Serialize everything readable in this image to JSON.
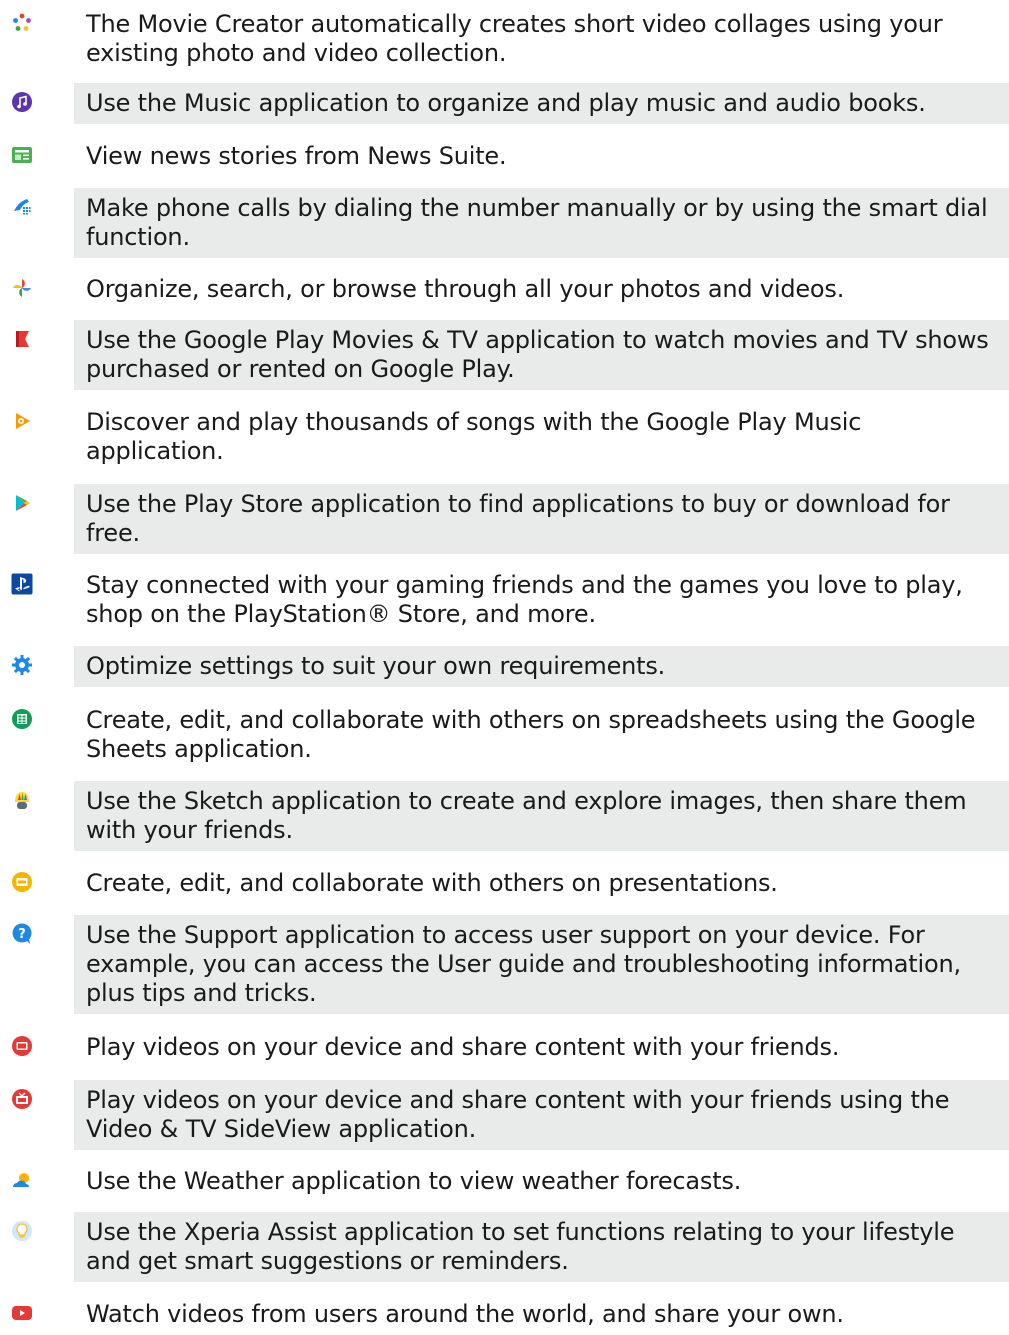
{
  "items": [
    {
      "icon": "movie-creator-icon",
      "text": "The Movie Creator automatically creates short video collages using your existing photo and video collection."
    },
    {
      "icon": "music-icon",
      "text": "Use the Music application to organize and play music and audio books."
    },
    {
      "icon": "news-icon",
      "text": "View news stories from News Suite."
    },
    {
      "icon": "phone-icon",
      "text": "Make phone calls by dialing the number manually or by using the smart dial function."
    },
    {
      "icon": "photos-icon",
      "text": "Organize, search, or browse through all your photos and videos."
    },
    {
      "icon": "play-movies-icon",
      "text": "Use the Google Play Movies & TV application to watch movies and TV shows purchased or rented on Google Play."
    },
    {
      "icon": "play-music-icon",
      "text": "Discover and play thousands of songs with the Google Play Music application."
    },
    {
      "icon": "play-store-icon",
      "text": "Use the Play Store application to find applications to buy or download for free."
    },
    {
      "icon": "playstation-icon",
      "text": "Stay connected with your gaming friends and the games you love to play, shop on the PlayStation® Store, and more."
    },
    {
      "icon": "settings-icon",
      "text": "Optimize settings to suit your own requirements."
    },
    {
      "icon": "sheets-icon",
      "text": "Create, edit, and collaborate with others on spreadsheets using the Google Sheets application."
    },
    {
      "icon": "sketch-icon",
      "text": "Use the Sketch application to create and explore images, then share them with your friends."
    },
    {
      "icon": "slides-icon",
      "text": "Create, edit, and collaborate with others on presentations."
    },
    {
      "icon": "support-icon",
      "text": "Use the Support application to access user support on your device. For example, you can access the User guide and troubleshooting information, plus tips and tricks."
    },
    {
      "icon": "video-icon",
      "text": "Play videos on your device and share content with your friends."
    },
    {
      "icon": "tv-sideview-icon",
      "text": "Play videos on your device and share content with your friends using the Video & TV SideView application."
    },
    {
      "icon": "weather-icon",
      "text": "Use the Weather application to view weather forecasts."
    },
    {
      "icon": "xperia-assist-icon",
      "text": "Use the Xperia Assist application to set functions relating to your lifestyle and get smart suggestions or reminders."
    },
    {
      "icon": "youtube-icon",
      "text": "Watch videos from users around the world, and share your own."
    }
  ]
}
